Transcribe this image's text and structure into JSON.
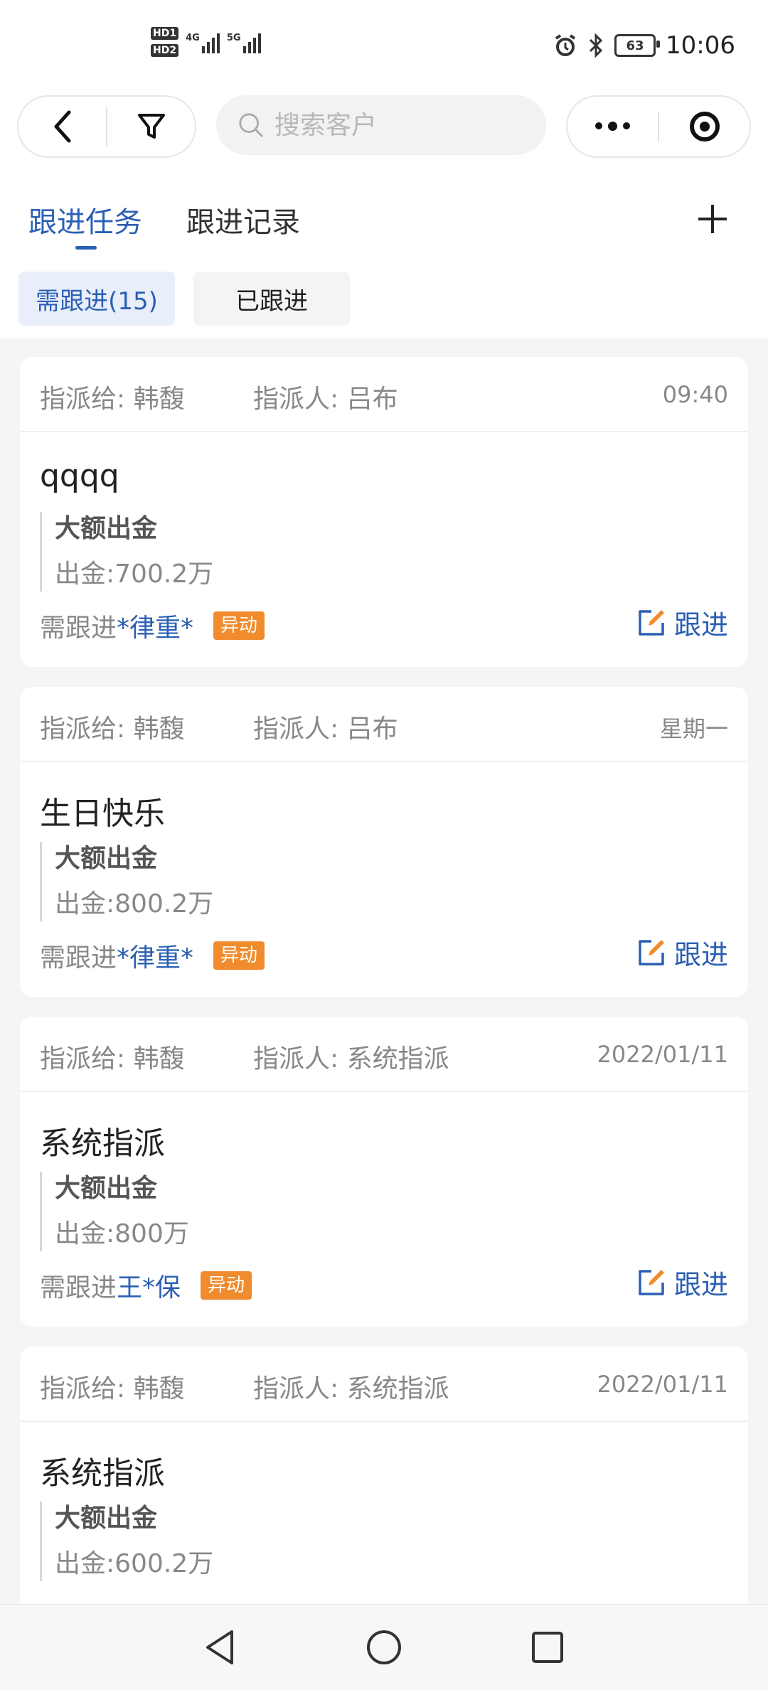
{
  "status_bar": {
    "hd1": "HD1",
    "hd2": "HD2",
    "net1": "4G",
    "net2": "5G",
    "battery": "63",
    "time": "10:06"
  },
  "nav": {
    "search_placeholder": "搜索客户"
  },
  "tabs": {
    "active": "跟进任务",
    "inactive": "跟进记录"
  },
  "subtabs": {
    "need_follow": "需跟进(15)",
    "followed": "已跟进"
  },
  "cards": [
    {
      "assignee": "指派给: 韩馥",
      "assigner": "指派人: 吕布",
      "datetime": "09:40",
      "title": "qqqq",
      "category": "大额出金",
      "amount": "出金:700.2万",
      "follow_label": "需跟进",
      "follow_name": "*律重*",
      "badge": "异动",
      "action": "跟进"
    },
    {
      "assignee": "指派给: 韩馥",
      "assigner": "指派人: 吕布",
      "datetime": "星期一",
      "title": "生日快乐",
      "category": "大额出金",
      "amount": "出金:800.2万",
      "follow_label": "需跟进",
      "follow_name": "*律重*",
      "badge": "异动",
      "action": "跟进"
    },
    {
      "assignee": "指派给: 韩馥",
      "assigner": "指派人: 系统指派",
      "datetime": "2022/01/11",
      "title": "系统指派",
      "category": "大额出金",
      "amount": "出金:800万",
      "follow_label": "需跟进",
      "follow_name": "王*保",
      "badge": "异动",
      "action": "跟进"
    },
    {
      "assignee": "指派给: 韩馥",
      "assigner": "指派人: 系统指派",
      "datetime": "2022/01/11",
      "title": "系统指派",
      "category": "大额出金",
      "amount": "出金:600.2万"
    }
  ],
  "colors": {
    "accent": "#2b5fb4",
    "badge": "#f08c2e"
  }
}
